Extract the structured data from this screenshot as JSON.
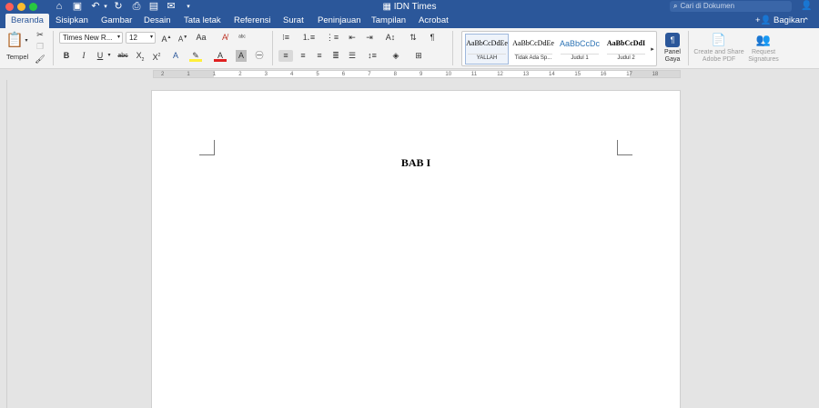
{
  "window": {
    "title": "IDN Times",
    "search_placeholder": "Cari di Dokumen"
  },
  "tabs": [
    {
      "label": "Beranda",
      "active": true
    },
    {
      "label": "Sisipkan"
    },
    {
      "label": "Gambar"
    },
    {
      "label": "Desain"
    },
    {
      "label": "Tata letak"
    },
    {
      "label": "Referensi"
    },
    {
      "label": "Surat"
    },
    {
      "label": "Peninjauan"
    },
    {
      "label": "Tampilan"
    },
    {
      "label": "Acrobat"
    }
  ],
  "share_label": "Bagikan",
  "ribbon": {
    "paste_label": "Tempel",
    "font_name": "Times New R...",
    "font_size": "12",
    "styles": [
      {
        "preview": "AaBbCcDdEe",
        "name": "YALLAH"
      },
      {
        "preview": "AaBbCcDdEe",
        "name": "Tidak Ada Sp..."
      },
      {
        "preview": "AaBbCcDc",
        "name": "Judul 1"
      },
      {
        "preview": "AaBbCcDdI",
        "name": "Judul 2"
      }
    ],
    "styles_pane_label_1": "Panel",
    "styles_pane_label_2": "Gaya",
    "adobe_label_1": "Create and Share",
    "adobe_label_2": "Adobe PDF",
    "signatures_label_1": "Request",
    "signatures_label_2": "Signatures"
  },
  "ruler": {
    "numbers": [
      "2",
      "1",
      "1",
      "2",
      "3",
      "4",
      "5",
      "6",
      "7",
      "8",
      "9",
      "10",
      "11",
      "12",
      "13",
      "14",
      "15",
      "16",
      "17",
      "18"
    ]
  },
  "document": {
    "heading": "BAB I"
  },
  "colors": {
    "accent": "#2b579a",
    "ribbon_bg": "#f3f3f3",
    "canvas_bg": "#e4e4e4"
  }
}
